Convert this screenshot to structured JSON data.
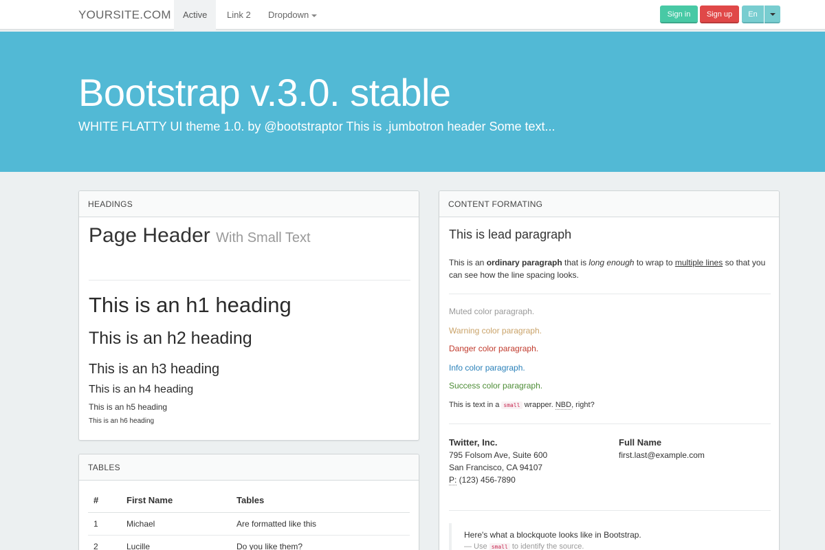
{
  "navbar": {
    "brand": "YOURSITE.COM",
    "items": [
      {
        "label": "Active"
      },
      {
        "label": "Link 2"
      },
      {
        "label": "Dropdown"
      }
    ],
    "signin_label": "Sign in",
    "signup_label": "Sign up",
    "lang_label": "En"
  },
  "jumbotron": {
    "title": "Bootstrap v.3.0. stable",
    "subtitle": "WHITE FLATTY UI theme 1.0. by @bootstraptor This is .jumbotron header Some text..."
  },
  "headings_panel": {
    "title": "HEADINGS",
    "page_header": "Page Header",
    "page_header_small": "With Small Text",
    "h1": "This is an h1 heading",
    "h2": "This is an h2 heading",
    "h3": "This is an h3 heading",
    "h4": "This is an h4 heading",
    "h5": "This is an h5 heading",
    "h6": "This is an h6 heading"
  },
  "tables_panel": {
    "title": "TABLES",
    "columns": [
      "#",
      "First Name",
      "Tables"
    ],
    "rows": [
      [
        "1",
        "Michael",
        "Are formatted like this"
      ],
      [
        "2",
        "Lucille",
        "Do you like them?"
      ]
    ]
  },
  "content_panel": {
    "title": "CONTENT FORMATING",
    "lead": "This is lead paragraph",
    "para": {
      "p1": "This is an ",
      "bold": "ordinary paragraph",
      "p2": " that is ",
      "italic": "long enough",
      "p3": " to wrap to ",
      "underline": "multiple lines",
      "p4": " so that you can see how the line spacing looks."
    },
    "muted": "Muted color paragraph.",
    "warning": "Warning color paragraph.",
    "danger": "Danger color paragraph.",
    "info": "Info color paragraph.",
    "success": "Success color paragraph.",
    "small_line": {
      "p1": "This is text in a ",
      "code": "small",
      "p2": " wrapper. ",
      "abbr": "NBD",
      "p3": ", right?"
    },
    "address1": {
      "name": "Twitter, Inc.",
      "line1": "795 Folsom Ave, Suite 600",
      "line2": "San Francisco, CA 94107",
      "phone_abbr": "P:",
      "phone": " (123) 456-7890"
    },
    "address2": {
      "name": "Full Name",
      "email": "first.last@example.com"
    },
    "blockquote": {
      "text": "Here's what a blockquote looks like in Bootstrap.",
      "src_pre": "— Use ",
      "src_code": "small",
      "src_post": " to identify the source."
    }
  },
  "colors": {
    "jumbotron": "#52b9d5",
    "signin": "#48c9a5",
    "signup": "#e04848",
    "lang": "#78cdd0",
    "background": "#ecf0f1"
  }
}
